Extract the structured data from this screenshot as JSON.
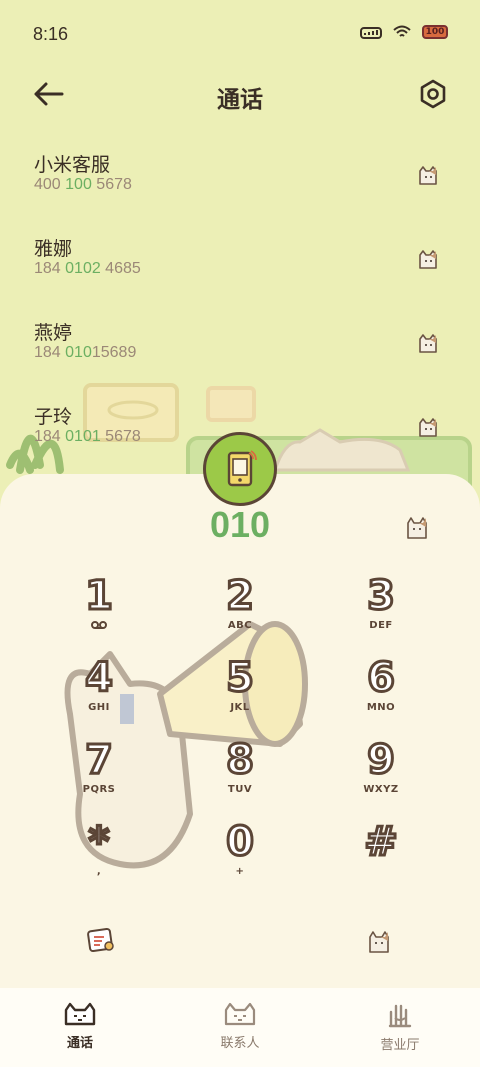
{
  "status": {
    "time": "8:16",
    "battery": "100"
  },
  "header": {
    "title": "通话"
  },
  "contacts": [
    {
      "name": "小米客服",
      "num_pre": "400 ",
      "num_hl": "100",
      "num_post": " 5678"
    },
    {
      "name": "雅娜",
      "num_pre": "184 ",
      "num_hl": "0102",
      "num_post": " 4685"
    },
    {
      "name": "燕婷",
      "num_pre": "184 ",
      "num_hl": "010",
      "num_post": "15689"
    },
    {
      "name": "子玲",
      "num_pre": "184 ",
      "num_hl": "0101",
      "num_post": " 5678"
    }
  ],
  "dialer": {
    "number": "010",
    "keys": [
      {
        "digit": "1",
        "letters": ""
      },
      {
        "digit": "2",
        "letters": "ABC"
      },
      {
        "digit": "3",
        "letters": "DEF"
      },
      {
        "digit": "4",
        "letters": "GHI"
      },
      {
        "digit": "5",
        "letters": "JKL"
      },
      {
        "digit": "6",
        "letters": "MNO"
      },
      {
        "digit": "7",
        "letters": "PQRS"
      },
      {
        "digit": "8",
        "letters": "TUV"
      },
      {
        "digit": "9",
        "letters": "WXYZ"
      },
      {
        "digit": "*",
        "letters": ","
      },
      {
        "digit": "0",
        "letters": "+"
      },
      {
        "digit": "#",
        "letters": ""
      }
    ]
  },
  "nav": [
    {
      "label": "通话",
      "active": true
    },
    {
      "label": "联系人",
      "active": false
    },
    {
      "label": "营业厅",
      "active": false
    }
  ],
  "colors": {
    "background": "#ecefb6",
    "panel": "#fbf6e4",
    "accent_green": "#6caf62",
    "call_button": "#9cc948",
    "outline_brown": "#5b4536"
  },
  "icons": {
    "back": "back-arrow-icon",
    "settings": "settings-hex-icon",
    "contact": "cat-icon",
    "notes": "notes-icon",
    "call": "call-phone-icon"
  }
}
